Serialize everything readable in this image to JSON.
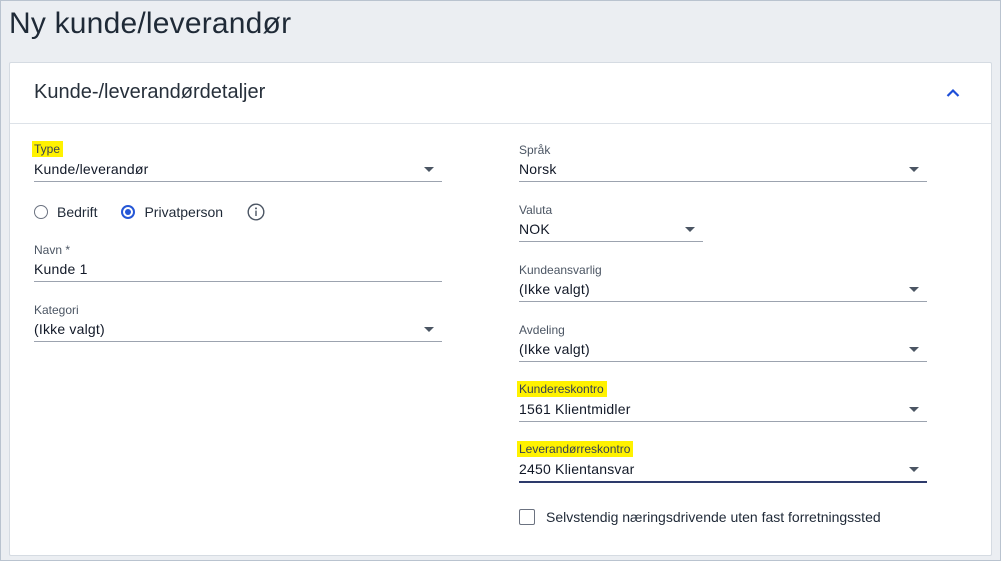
{
  "page": {
    "title": "Ny kunde/leverandør"
  },
  "card": {
    "title": "Kunde-/leverandørdetaljer",
    "collapse_icon": "chevron-up-icon"
  },
  "left": {
    "type": {
      "label": "Type",
      "value": "Kunde/leverandør"
    },
    "radios": [
      {
        "label": "Bedrift",
        "checked": false
      },
      {
        "label": "Privatperson",
        "checked": true
      }
    ],
    "info_icon": "info-icon",
    "name": {
      "label": "Navn *",
      "value": "Kunde 1"
    },
    "category": {
      "label": "Kategori",
      "value": "(Ikke valgt)"
    }
  },
  "right": {
    "language": {
      "label": "Språk",
      "value": "Norsk"
    },
    "currency": {
      "label": "Valuta",
      "value": "NOK"
    },
    "responsible": {
      "label": "Kundeansvarlig",
      "value": "(Ikke valgt)"
    },
    "department": {
      "label": "Avdeling",
      "value": "(Ikke valgt)"
    },
    "customer_ledger": {
      "label": "Kundereskontro",
      "value": "1561 Klientmidler"
    },
    "supplier_ledger": {
      "label": "Leverandørreskontro",
      "value": "2450 Klientansvar"
    },
    "self_employed": {
      "label": "Selvstendig næringsdrivende uten fast forretningssted",
      "checked": false
    }
  },
  "colors": {
    "highlight": "#fff200",
    "accent": "#2557d6",
    "active_underline": "#2d3a6b"
  }
}
